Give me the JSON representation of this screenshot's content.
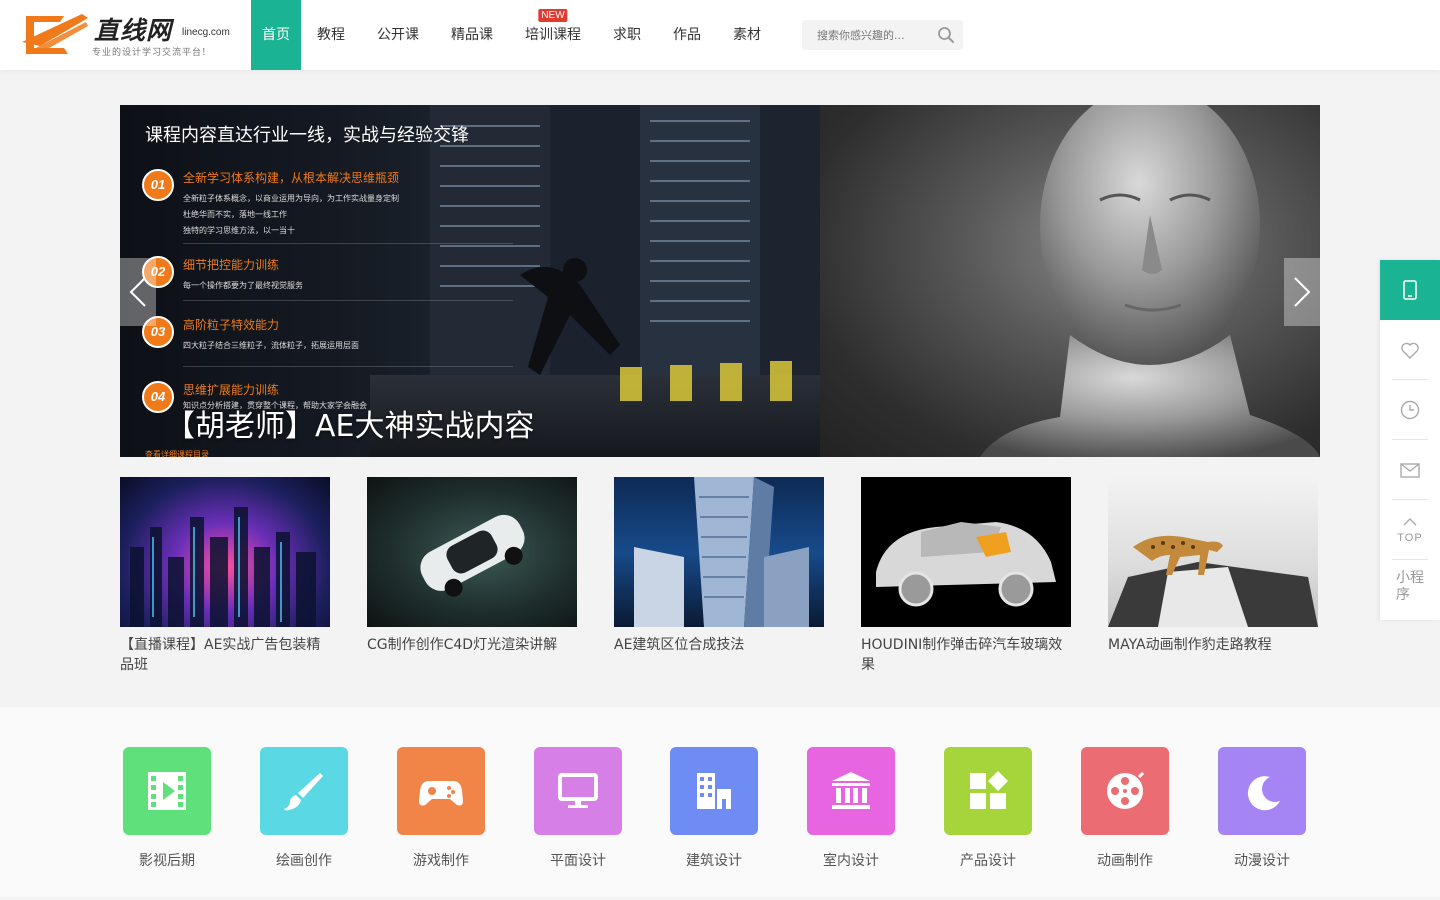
{
  "brand": {
    "name": "直线网",
    "domain": "linecg.com",
    "slogan": "专业的设计学习交流平台!",
    "accent_color": "#1ab394",
    "logo_color": "#f07a1a"
  },
  "nav": {
    "items": [
      {
        "label": "首页",
        "active": true
      },
      {
        "label": "教程"
      },
      {
        "label": "公开课"
      },
      {
        "label": "精品课"
      },
      {
        "label": "培训课程",
        "badge": "NEW"
      },
      {
        "label": "求职"
      },
      {
        "label": "作品"
      },
      {
        "label": "素材"
      }
    ]
  },
  "search": {
    "placeholder": "搜索你感兴趣的...",
    "icon": "search-icon"
  },
  "banner": {
    "heading": "课程内容直达行业一线，实战与经验交锋",
    "features": [
      {
        "num": "01",
        "title": "全新学习体系构建，从根本解决思维瓶颈",
        "desc": "全新粒子体系概念，以商业运用为导向，为工作实战量身定制\n杜绝华而不实，落地一线工作\n独特的学习思维方法，以一当十"
      },
      {
        "num": "02",
        "title": "细节把控能力训练",
        "desc": "每一个操作都要为了最终视觉服务"
      },
      {
        "num": "03",
        "title": "高阶粒子特效能力",
        "desc": "四大粒子结合三维粒子，流体粒子，拓展运用层面"
      },
      {
        "num": "04",
        "title": "思维扩展能力训练",
        "desc": "知识点分析搭建，贯穿整个课程，帮助大家学会融会"
      }
    ],
    "caption": "【胡老师】AE大神实战内容",
    "more": "查看详细课程目录",
    "prev_icon": "chevron-left-icon",
    "next_icon": "chevron-right-icon"
  },
  "thumbs": [
    {
      "title": "【直播课程】AE实战广告包装精品班"
    },
    {
      "title": "CG制作创作C4D灯光渲染讲解"
    },
    {
      "title": "AE建筑区位合成技法"
    },
    {
      "title": "HOUDINI制作弹击碎汽车玻璃效果"
    },
    {
      "title": "MAYA动画制作豹走路教程"
    }
  ],
  "categories": [
    {
      "label": "影视后期",
      "color": "#5fe07b",
      "icon": "film-icon"
    },
    {
      "label": "绘画创作",
      "color": "#5ad8e3",
      "icon": "brush-icon"
    },
    {
      "label": "游戏制作",
      "color": "#f08547",
      "icon": "gamepad-icon"
    },
    {
      "label": "平面设计",
      "color": "#d67fe6",
      "icon": "monitor-icon"
    },
    {
      "label": "建筑设计",
      "color": "#6f8cf5",
      "icon": "building-icon"
    },
    {
      "label": "室内设计",
      "color": "#e765e0",
      "icon": "museum-icon"
    },
    {
      "label": "产品设计",
      "color": "#a6d43b",
      "icon": "shapes-icon"
    },
    {
      "label": "动画制作",
      "color": "#ec6c73",
      "icon": "film-reel-icon"
    },
    {
      "label": "动漫设计",
      "color": "#a585f4",
      "icon": "moon-icon"
    }
  ],
  "sidebar": {
    "items": [
      {
        "icon": "tablet-icon"
      },
      {
        "icon": "heart-icon"
      },
      {
        "icon": "clock-icon"
      },
      {
        "icon": "mail-icon"
      },
      {
        "icon": "back-to-top-icon",
        "label": "TOP"
      },
      {
        "label": "小程序"
      }
    ]
  }
}
